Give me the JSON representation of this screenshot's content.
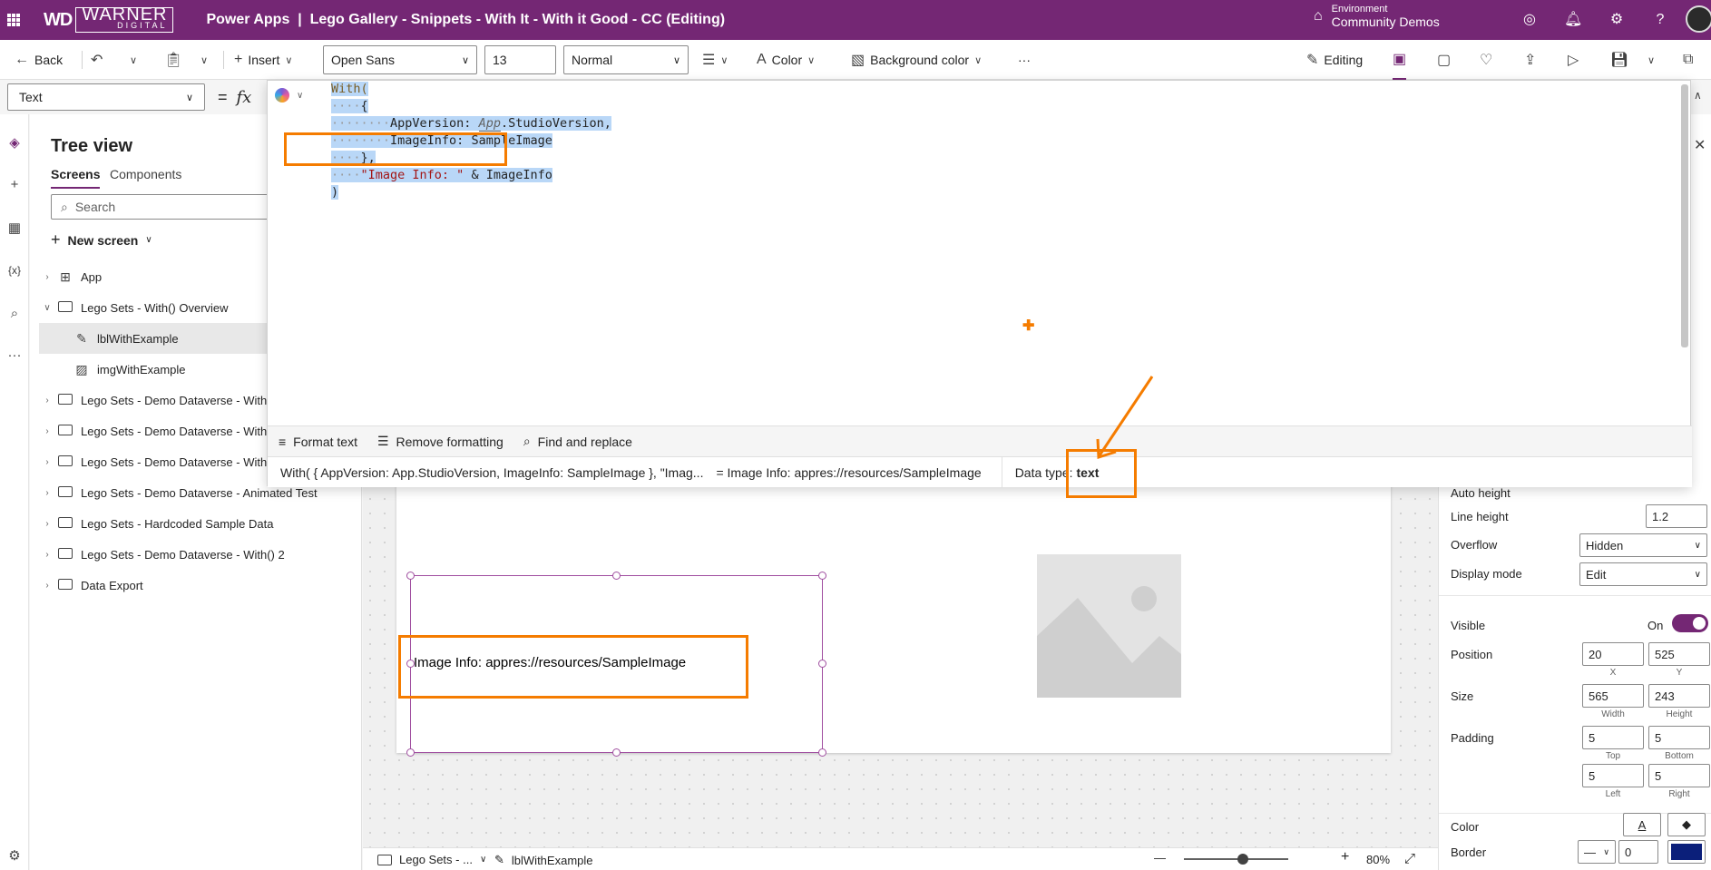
{
  "titlebar": {
    "brand_mark": "WD",
    "brand_name": "WARNER",
    "brand_sub": "DIGITAL",
    "app_title": "Power Apps  |  Lego Gallery - Snippets - With It - With it Good - CC (Editing)",
    "environment_label": "Environment",
    "environment_name": "Community Demos",
    "bg_color": "#742774"
  },
  "cmdbar": {
    "back": "Back",
    "insert": "Insert",
    "font": "Open Sans",
    "font_size": "13",
    "font_weight": "Normal",
    "color": "Color",
    "background_color": "Background color",
    "more": "···",
    "editing": "Editing"
  },
  "formula_bar": {
    "property": "Text",
    "equals": "=",
    "fx": "fx"
  },
  "code": {
    "l1": "With(",
    "l2_open": "{",
    "l3_key": "AppVersion:",
    "l3_obj": "App",
    "l3_rest": ".StudioVersion,",
    "l4_key": "ImageInfo:",
    "l4_val": "SampleImage",
    "l5": "},",
    "l6_str": "\"Image Info: \"",
    "l6_amp": "&",
    "l6_ref": "ImageInfo",
    "l7": ")"
  },
  "format_bar": {
    "format_text": "Format text",
    "remove_formatting": "Remove formatting",
    "find_replace": "Find and replace"
  },
  "status_bar": {
    "expression": "With( { AppVersion: App.StudioVersion, ImageInfo: SampleImage }, \"Imag...",
    "result": "=  Image Info: appres://resources/SampleImage",
    "data_type_label": "Data type:",
    "data_type_value": "text"
  },
  "tree": {
    "title": "Tree view",
    "tabs": [
      "Screens",
      "Components"
    ],
    "search_placeholder": "Search",
    "new_screen": "New screen",
    "items": [
      {
        "label": "App"
      },
      {
        "label": "Lego Sets - With() Overview"
      },
      {
        "label": "lblWithExample"
      },
      {
        "label": "imgWithExample"
      },
      {
        "label": "Lego Sets - Demo Dataverse - With"
      },
      {
        "label": "Lego Sets - Demo Dataverse - With"
      },
      {
        "label": "Lego Sets - Demo Dataverse - With"
      },
      {
        "label": "Lego Sets - Demo Dataverse - Animated Test"
      },
      {
        "label": "Lego Sets - Hardcoded Sample Data"
      },
      {
        "label": "Lego Sets - Demo Dataverse - With() 2"
      },
      {
        "label": "Data Export"
      }
    ]
  },
  "canvas": {
    "label_text": "Image Info: appres://resources/SampleImage",
    "highlight_color": "#f57c00"
  },
  "props": {
    "auto_height": "Auto height",
    "line_height": "Line height",
    "line_height_val": "1.2",
    "overflow": "Overflow",
    "overflow_val": "Hidden",
    "display_mode": "Display mode",
    "display_mode_val": "Edit",
    "visible": "Visible",
    "visible_val": "On",
    "position": "Position",
    "pos_x": "20",
    "pos_y": "525",
    "pos_x_lbl": "X",
    "pos_y_lbl": "Y",
    "size": "Size",
    "width": "565",
    "height": "243",
    "width_lbl": "Width",
    "height_lbl": "Height",
    "padding": "Padding",
    "pad_top": "5",
    "pad_bottom": "5",
    "pad_top_lbl": "Top",
    "pad_bottom_lbl": "Bottom",
    "pad_left": "5",
    "pad_right": "5",
    "pad_left_lbl": "Left",
    "pad_right_lbl": "Right",
    "color": "Color",
    "border": "Border",
    "border_width": "0",
    "border_color": "#0b1f7a"
  },
  "bottombar": {
    "screen": "Lego Sets - ...",
    "control": "lblWithExample",
    "zoom": "80%",
    "minus": "—",
    "plus": "+"
  }
}
